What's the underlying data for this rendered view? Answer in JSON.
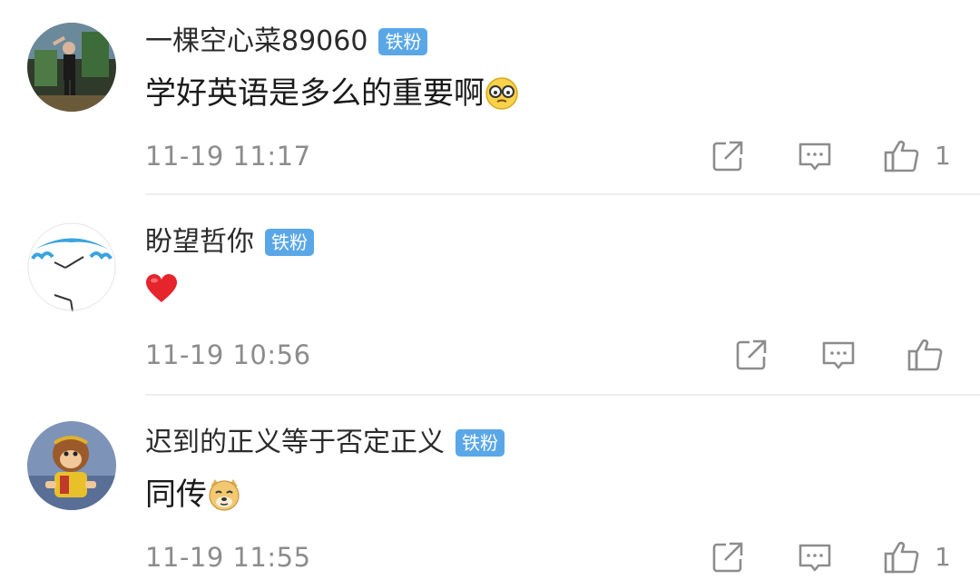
{
  "comments": [
    {
      "username": "一棵空心菜89060",
      "badge": "铁粉",
      "text": "学好英语是多么的重要啊",
      "emoji": "glasses-face-emoji",
      "time": "11-19 11:17",
      "like_count": "1"
    },
    {
      "username": "盼望哲你",
      "badge": "铁粉",
      "text": "",
      "emoji": "red-heart-emoji",
      "time": "11-19 10:56",
      "like_count": ""
    },
    {
      "username": "迟到的正义等于否定正义",
      "badge": "铁粉",
      "text": "同传",
      "emoji": "doge-emoji",
      "time": "11-19 11:55",
      "like_count": "1"
    }
  ],
  "icons": {
    "share": "share-icon",
    "reply": "comment-icon",
    "like": "thumbs-up-icon"
  },
  "colors": {
    "badge_bg": "#5aa7e8",
    "meta_text": "#8c8c8c",
    "divider": "#eeeeee"
  }
}
